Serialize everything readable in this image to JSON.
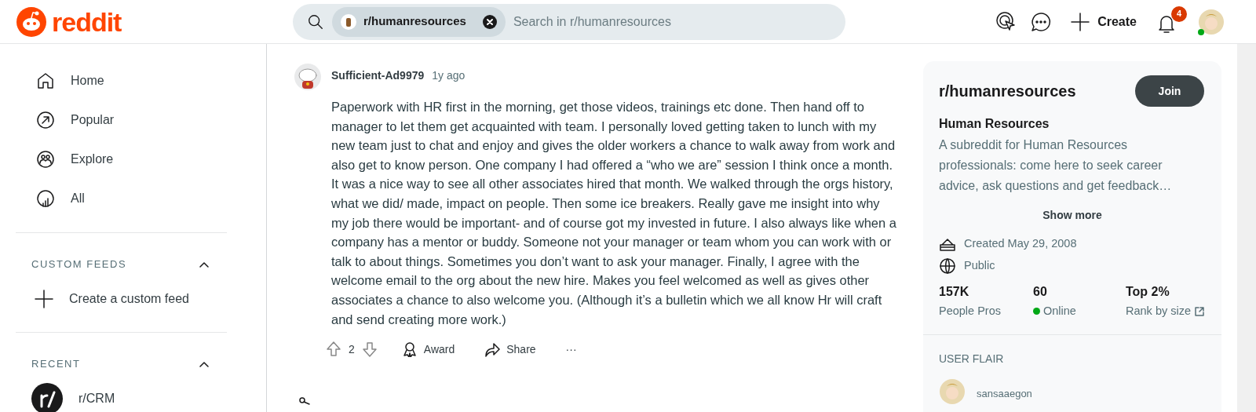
{
  "header": {
    "logo_text": "reddit",
    "search": {
      "chip": "r/humanresources",
      "placeholder": "Search in r/humanresources"
    },
    "create": "Create",
    "notifications": "4"
  },
  "sidebar": {
    "nav": [
      {
        "label": "Home"
      },
      {
        "label": "Popular"
      },
      {
        "label": "Explore"
      },
      {
        "label": "All"
      }
    ],
    "sections": [
      {
        "title": "CUSTOM FEEDS",
        "expanded": true,
        "items": [
          {
            "kind": "create",
            "label": "Create a custom feed"
          }
        ]
      },
      {
        "title": "RECENT",
        "expanded": true,
        "items": [
          {
            "kind": "community",
            "label": "r/CRM"
          }
        ]
      }
    ]
  },
  "comment": {
    "author": "Sufficient-Ad9979",
    "time": "1y ago",
    "body": "Paperwork with HR first in the morning, get those videos, trainings etc done. Then hand off to manager to let them get acquainted with team. I personally loved getting taken to lunch with my new team just to chat and enjoy and gives the older workers a chance to walk away from work and also get to know person. One company I had offered a “who we are” session I think once a month. It was a nice way to see all other associates hired that month. We walked through the orgs history, what we did/ made, impact on people. Then some ice breakers. Really gave me insight into why my job there would be important- and of course got my invested in future. I also always like when a company has a mentor or buddy. Someone not your manager or team whom you can work with or talk to about things. Sometimes you don’t want to ask your manager. Finally, I agree with the welcome email to the org about the new hire. Makes you feel welcomed as well as gives other associates a chance to also welcome you. (Although it’s a bulletin which we all know Hr will craft and send creating more work.)",
    "votes": "2",
    "actions": [
      "Award",
      "Share",
      "···"
    ]
  },
  "community": {
    "name": "r/humanresources",
    "join": "Join",
    "title": "Human Resources",
    "description": "A subreddit for Human Resources professionals: come here to seek career advice, ask questions and get feedback…",
    "show_more": "Show more",
    "created": "Created May 29, 2008",
    "visibility": "Public",
    "stats": [
      {
        "value": "157K",
        "label": "People Pros",
        "kind": "plain"
      },
      {
        "value": "60",
        "label": "Online",
        "kind": "online"
      },
      {
        "value": "Top 2%",
        "label": "Rank by size",
        "kind": "link"
      }
    ],
    "user_flair": {
      "title": "USER FLAIR",
      "user": "sansaaegon"
    }
  }
}
